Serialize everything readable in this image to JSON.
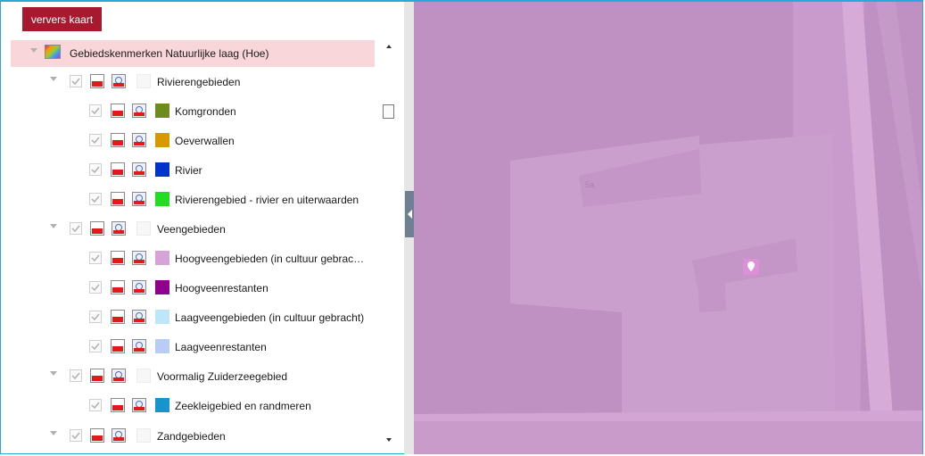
{
  "toolbar": {
    "refresh_label": "ververs kaart"
  },
  "root_layer": {
    "label": "Gebiedskenmerken Natuurlijke laag (Hoe)"
  },
  "groups": [
    {
      "label": "Rivierengebieden",
      "items": [
        {
          "label": "Komgronden",
          "color": "#6e8b1e"
        },
        {
          "label": "Oeverwallen",
          "color": "#d69a00"
        },
        {
          "label": "Rivier",
          "color": "#0033cc"
        },
        {
          "label": "Rivierengebied - rivier en uiterwaarden",
          "color": "#22dd22"
        }
      ]
    },
    {
      "label": "Veengebieden",
      "items": [
        {
          "label": "Hoogveengebieden (in cultuur gebrac…",
          "color": "#d6a2d8"
        },
        {
          "label": "Hoogveenrestanten",
          "color": "#8e008e"
        },
        {
          "label": "Laagveengebieden (in cultuur gebracht)",
          "color": "#bde6f9"
        },
        {
          "label": "Laagveenrestanten",
          "color": "#b9ccf6"
        }
      ]
    },
    {
      "label": "Voormalig Zuiderzeegebied",
      "items": [
        {
          "label": "Zeekleigebied en randmeren",
          "color": "#1595c9"
        }
      ]
    },
    {
      "label": "Zandgebieden",
      "items": []
    }
  ],
  "map": {
    "building_label": "5a",
    "colors": {
      "background": "#bf91c3",
      "parcel_light": "#cfa3d1",
      "road": "#d9aed9",
      "marker": "#dd8fd8"
    }
  }
}
